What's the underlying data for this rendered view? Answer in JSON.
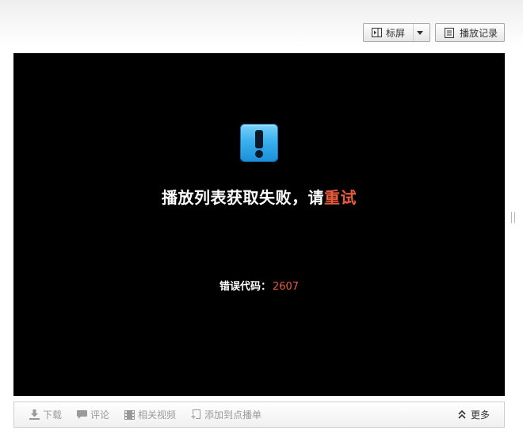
{
  "controls": {
    "mode_label": "标屏",
    "history_label": "播放记录"
  },
  "player": {
    "error_message": "播放列表获取失败，请",
    "retry_label": "重试",
    "error_code_label": "错误代码：",
    "error_code_value": "2607"
  },
  "bottom_bar": {
    "items": [
      {
        "label": "下载",
        "icon": "download-icon"
      },
      {
        "label": "评论",
        "icon": "comment-icon"
      },
      {
        "label": "相关视频",
        "icon": "film-icon"
      },
      {
        "label": "添加到点播单",
        "icon": "add-playlist-icon"
      }
    ],
    "more_label": "更多"
  },
  "colors": {
    "accent": "#e65b3c",
    "player_bg": "#000000",
    "icon_blue": "#3ab0ee"
  }
}
